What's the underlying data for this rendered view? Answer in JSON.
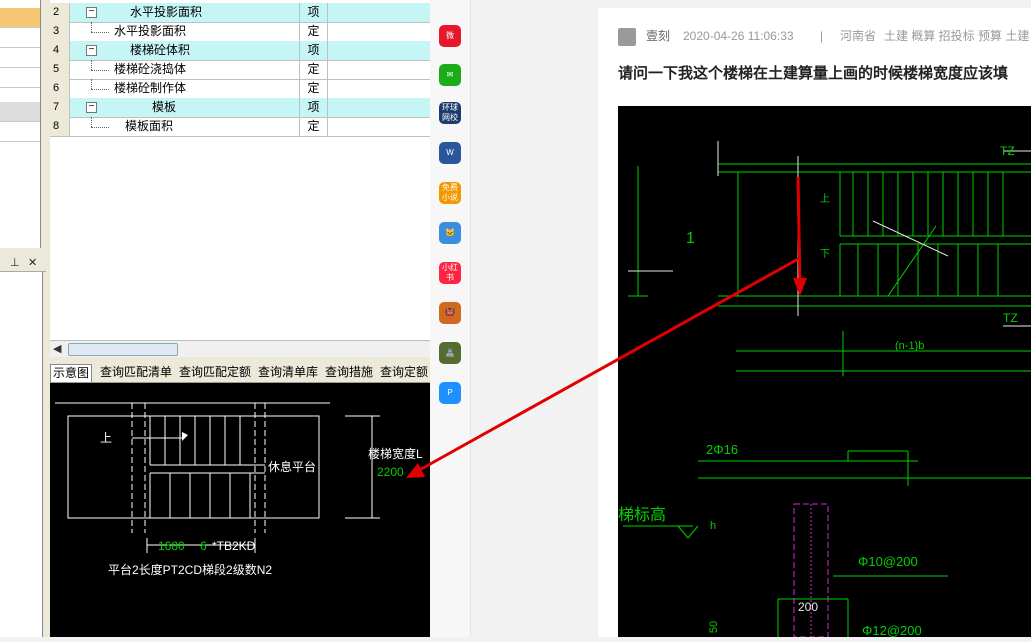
{
  "grid": {
    "rows": [
      {
        "num": "2",
        "name": "水平投影面积",
        "unit": "项",
        "level": 0,
        "highlight": true
      },
      {
        "num": "3",
        "name": "水平投影面积",
        "unit": "定",
        "level": 1,
        "highlight": false
      },
      {
        "num": "4",
        "name": "楼梯砼体积",
        "unit": "项",
        "level": 0,
        "highlight": true
      },
      {
        "num": "5",
        "name": "楼梯砼浇捣体",
        "unit": "定",
        "level": 1,
        "highlight": false
      },
      {
        "num": "6",
        "name": "楼梯砼制作体",
        "unit": "定",
        "level": 1,
        "highlight": false
      },
      {
        "num": "7",
        "name": "模板",
        "unit": "项",
        "level": 0,
        "highlight": true
      },
      {
        "num": "8",
        "name": "模板面积",
        "unit": "定",
        "level": 1,
        "highlight": false
      }
    ],
    "toggle_symbol": "−"
  },
  "panel": {
    "pin_icon": "pin-icon",
    "close_icon": "close-icon",
    "pin_glyph": "⊥",
    "close_glyph": "✕"
  },
  "tabs": [
    "示意图",
    "查询匹配清单",
    "查询匹配定额",
    "查询清单库",
    "查询措施",
    "查询定额"
  ],
  "diagram": {
    "up_label": "上",
    "landing_label": "休息平台",
    "width_label": "楼梯宽度L",
    "width_value": "2200",
    "dim1": "1680",
    "dim2": "6",
    "dim3": "*TB2KD",
    "bottom_label": "平台2长度PT2CD梯段2级数N2"
  },
  "sidebar": {
    "icons": [
      {
        "name": "weibo-icon",
        "text": "微",
        "color": "#e6162d"
      },
      {
        "name": "mail-icon",
        "text": "✉",
        "color": "#1aad19"
      },
      {
        "name": "huanqiu-icon",
        "text": "环球 网校",
        "color": "#1c3c6e"
      },
      {
        "name": "word-doc-icon",
        "text": "W",
        "color": "#2b579a"
      },
      {
        "name": "free-novel-icon",
        "text": "免费 小说",
        "color": "#f39800"
      },
      {
        "name": "game-icon-1",
        "text": "🐱",
        "color": "#3b8de0"
      },
      {
        "name": "xiaohongshu-icon",
        "text": "小红书",
        "color": "#ff2442"
      },
      {
        "name": "game-icon-2",
        "text": "👹",
        "color": "#d2691e"
      },
      {
        "name": "game-icon-3",
        "text": "🏯",
        "color": "#556b2f"
      },
      {
        "name": "p-app-icon",
        "text": "P",
        "color": "#1e90ff"
      }
    ]
  },
  "article": {
    "author": "壹刻",
    "date": "2020-04-26 11:06:33",
    "separator": "|",
    "location": "河南省",
    "tags": "土建 概算 招投标 预算 土建",
    "question": "请问一下我这个楼梯在土建算量上画的时候楼梯宽度应该填",
    "cad": {
      "tz1": "TZ",
      "tz2": "TZ",
      "up": "上",
      "down": "下",
      "one": "1",
      "span": "(n-1)b",
      "rebar1": "2Φ16",
      "level": "梯标高",
      "rebar2": "Φ10@200",
      "dim200": "200",
      "rebar3": "Φ12@200",
      "h": "h",
      "bottom_num": "50"
    }
  },
  "colors": {
    "arrow": "#e00000",
    "cad_green": "#00d000",
    "cad_white": "#e8e8e8",
    "cad_magenta": "#d030d0"
  }
}
